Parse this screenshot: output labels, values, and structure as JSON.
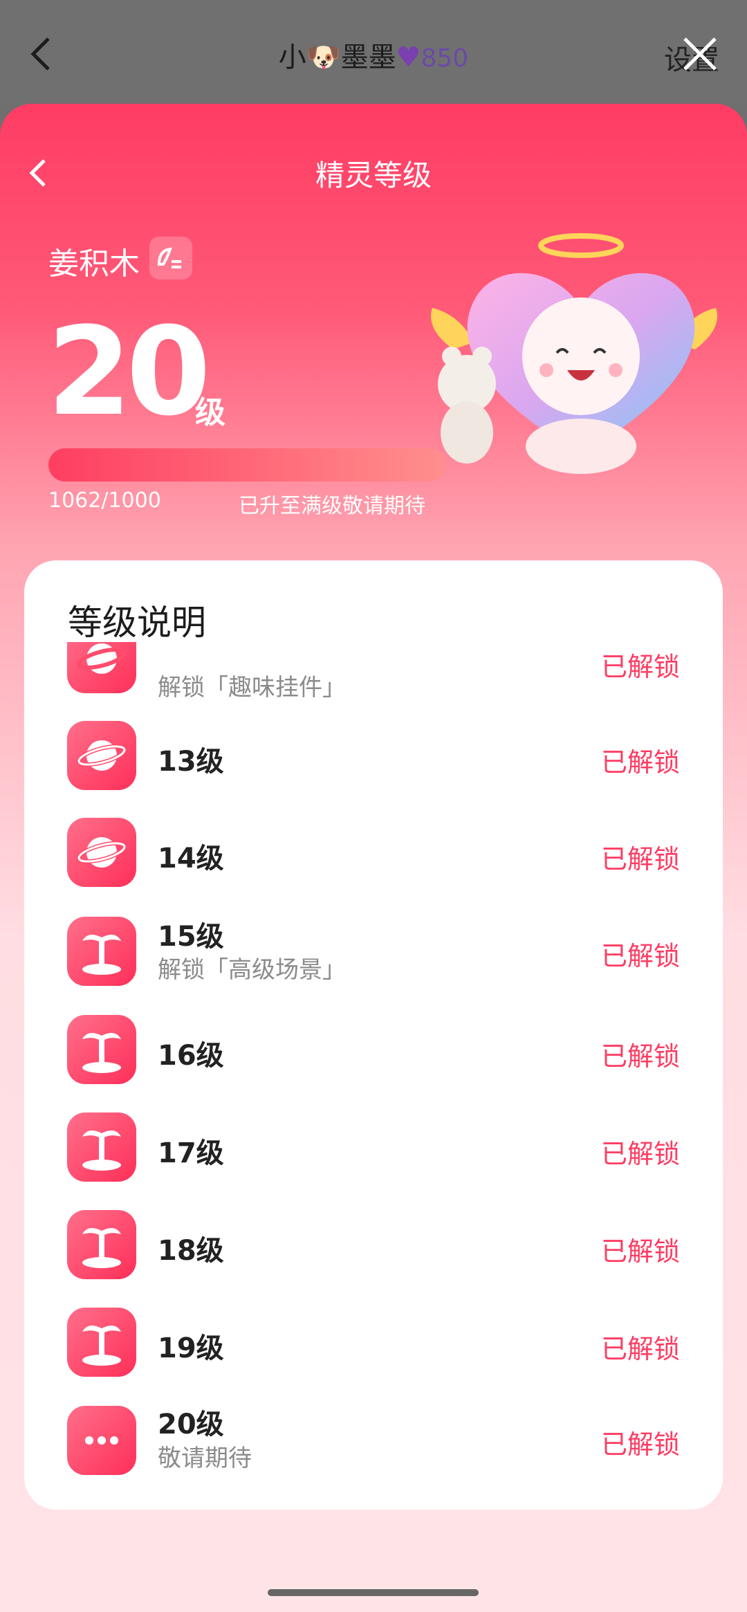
{
  "topbar": {
    "title_prefix": "小",
    "title_name": "墨墨",
    "intimacy": "850",
    "settings_label": "设置"
  },
  "sheet": {
    "title": "精灵等级"
  },
  "profile": {
    "name": "姜积木",
    "level": "20",
    "level_unit": "级",
    "progress_text": "1062/1000",
    "progress_fraction": 1.0,
    "status_text": "已升至满级敬请期待"
  },
  "card": {
    "title": "等级说明",
    "items": [
      {
        "label": "",
        "desc": "解锁「趣味挂件」",
        "status": "已解锁",
        "icon": "planet-icon"
      },
      {
        "label": "13级",
        "desc": "",
        "status": "已解锁",
        "icon": "planet-icon"
      },
      {
        "label": "14级",
        "desc": "",
        "status": "已解锁",
        "icon": "planet-icon"
      },
      {
        "label": "15级",
        "desc": "解锁「高级场景」",
        "status": "已解锁",
        "icon": "palm-tree-icon"
      },
      {
        "label": "16级",
        "desc": "",
        "status": "已解锁",
        "icon": "palm-tree-icon"
      },
      {
        "label": "17级",
        "desc": "",
        "status": "已解锁",
        "icon": "palm-tree-icon"
      },
      {
        "label": "18级",
        "desc": "",
        "status": "已解锁",
        "icon": "palm-tree-icon"
      },
      {
        "label": "19级",
        "desc": "",
        "status": "已解锁",
        "icon": "palm-tree-icon"
      },
      {
        "label": "20级",
        "desc": "敬请期待",
        "status": "已解锁",
        "icon": "more-icon"
      }
    ]
  },
  "colors": {
    "accent": "#ff3c63",
    "status": "#ff3c63",
    "bg_top": "#ff3c63",
    "bg_bottom": "#ffe4e7"
  }
}
